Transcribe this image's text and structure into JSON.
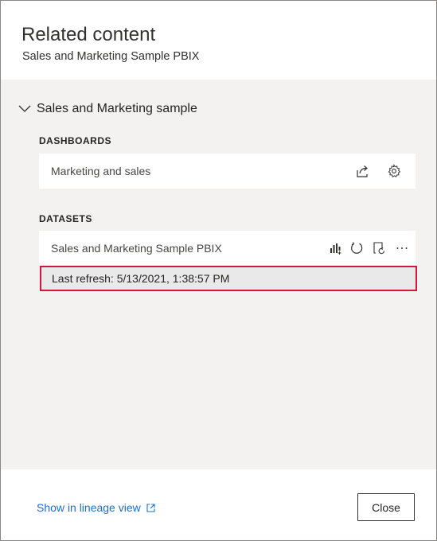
{
  "header": {
    "title": "Related content",
    "subtitle": "Sales and Marketing Sample PBIX"
  },
  "group": {
    "name": "Sales and Marketing sample",
    "expanded": true
  },
  "dashboards": {
    "label": "DASHBOARDS",
    "items": [
      {
        "name": "Marketing and sales",
        "icons": [
          "share-icon",
          "gear-icon"
        ]
      }
    ]
  },
  "datasets": {
    "label": "DATASETS",
    "items": [
      {
        "name": "Sales and Marketing Sample PBIX",
        "icons": [
          "create-report-icon",
          "refresh-icon",
          "schedule-refresh-icon",
          "more-options-icon"
        ],
        "last_refresh": "Last refresh: 5/13/2021, 1:38:57 PM"
      }
    ]
  },
  "footer": {
    "lineage_link": "Show in lineage view",
    "close_label": "Close"
  },
  "colors": {
    "link": "#1b70c4",
    "highlight_border": "#d5153d",
    "panel_bg": "#f3f2f1"
  }
}
